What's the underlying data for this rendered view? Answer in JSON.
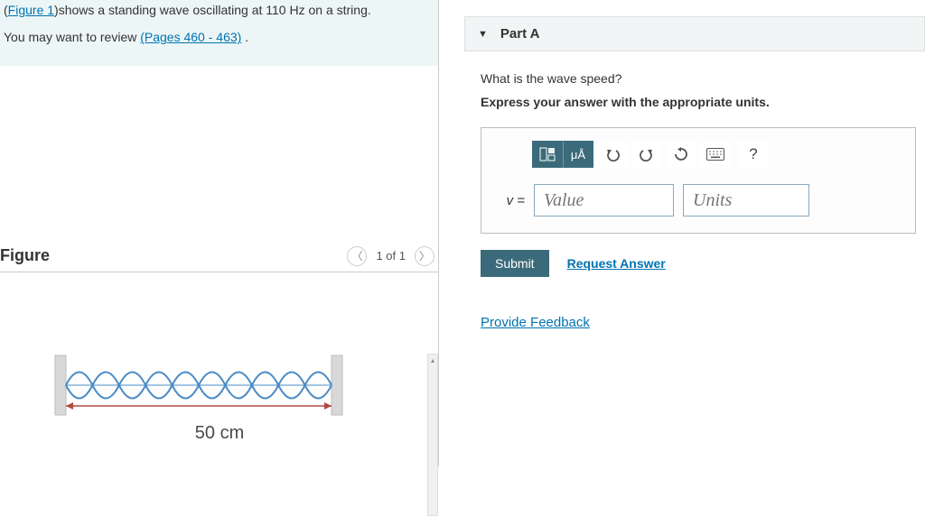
{
  "intro": {
    "figure_link": "Figure 1",
    "sentence_rest": "shows a standing wave oscillating at 110 Hz on a string.",
    "review_prefix": "You may want to review ",
    "pages_link": "(Pages 460 - 463)",
    "review_suffix": " ."
  },
  "figure": {
    "title": "Figure",
    "counter": "1 of 1",
    "length_label": "50 cm"
  },
  "part": {
    "label": "Part A",
    "question": "What is the wave speed?",
    "instruction": "Express your answer with the appropriate units.",
    "toolbar": {
      "units_label": "μÅ",
      "help_label": "?"
    },
    "eq_label": "v =",
    "value_placeholder": "Value",
    "units_placeholder": "Units",
    "submit_label": "Submit",
    "request_label": "Request Answer"
  },
  "feedback_label": "Provide Feedback"
}
